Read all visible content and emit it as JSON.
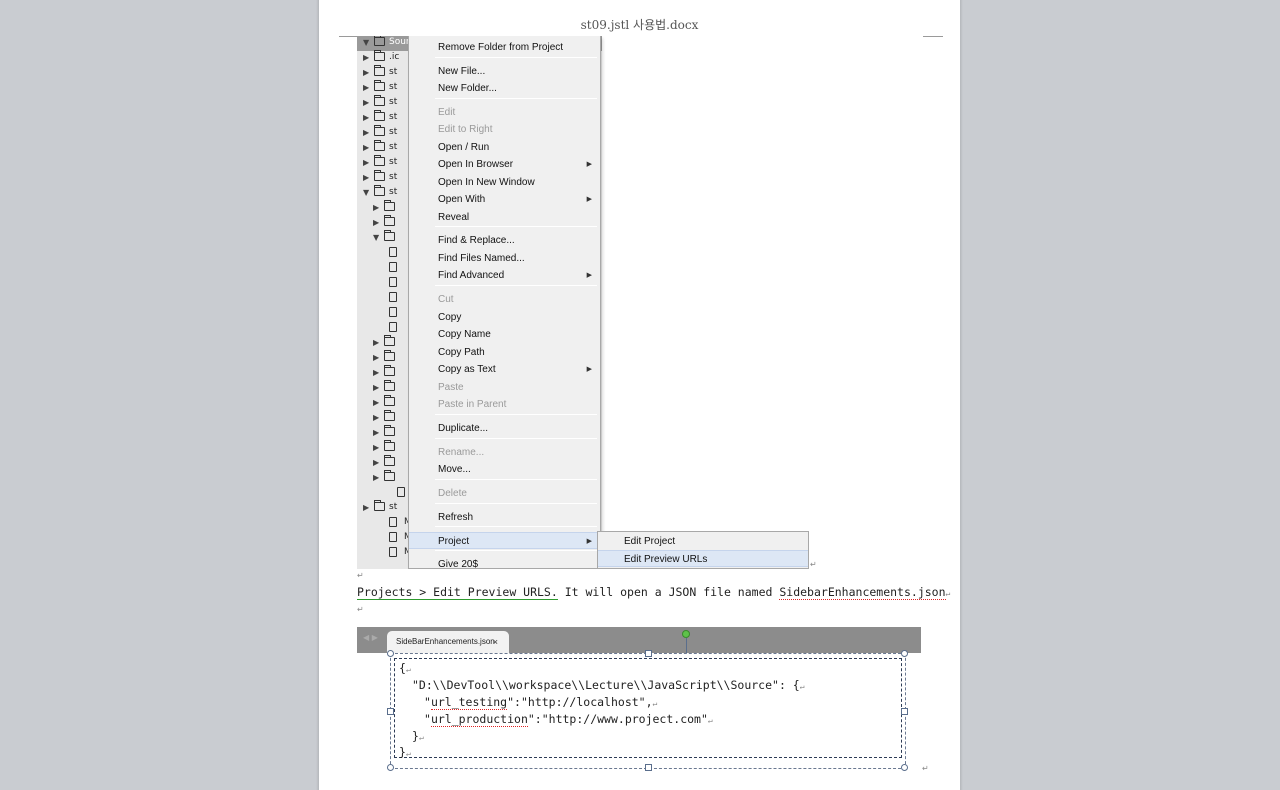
{
  "document": {
    "title": "st09.jstl 사용법.docx",
    "paragraph_mark": "↵"
  },
  "tree": {
    "root_label": "Sour",
    "rows": [
      {
        "label": ".ic"
      },
      {
        "label": "st"
      },
      {
        "label": "st"
      },
      {
        "label": "st"
      },
      {
        "label": "st"
      },
      {
        "label": "st"
      },
      {
        "label": "st"
      },
      {
        "label": "st"
      },
      {
        "label": "st"
      },
      {
        "label": "st"
      },
      {
        "label": "st"
      },
      {
        "label": "M"
      },
      {
        "label": "M"
      },
      {
        "label": "M"
      }
    ]
  },
  "context_menu": {
    "items": [
      {
        "label": "Remove Folder from Project",
        "enabled": true
      },
      {
        "label": "New File...",
        "enabled": true
      },
      {
        "label": "New Folder...",
        "enabled": true
      },
      {
        "label": "Edit",
        "enabled": false
      },
      {
        "label": "Edit to Right",
        "enabled": false
      },
      {
        "label": "Open / Run",
        "enabled": true
      },
      {
        "label": "Open In Browser",
        "enabled": true,
        "submenu": true
      },
      {
        "label": "Open In New Window",
        "enabled": true
      },
      {
        "label": "Open With",
        "enabled": true,
        "submenu": true
      },
      {
        "label": "Reveal",
        "enabled": true
      },
      {
        "label": "Find & Replace...",
        "enabled": true
      },
      {
        "label": "Find Files Named...",
        "enabled": true
      },
      {
        "label": "Find Advanced",
        "enabled": true,
        "submenu": true
      },
      {
        "label": "Cut",
        "enabled": false
      },
      {
        "label": "Copy",
        "enabled": true
      },
      {
        "label": "Copy Name",
        "enabled": true
      },
      {
        "label": "Copy Path",
        "enabled": true
      },
      {
        "label": "Copy as Text",
        "enabled": true,
        "submenu": true
      },
      {
        "label": "Paste",
        "enabled": false
      },
      {
        "label": "Paste in Parent",
        "enabled": false
      },
      {
        "label": "Duplicate...",
        "enabled": true
      },
      {
        "label": "Rename...",
        "enabled": false
      },
      {
        "label": "Move...",
        "enabled": true
      },
      {
        "label": "Delete",
        "enabled": false
      },
      {
        "label": "Refresh",
        "enabled": true
      },
      {
        "label": "Project",
        "enabled": true,
        "submenu": true,
        "highlighted": true
      },
      {
        "label": "Give 20$",
        "enabled": true
      }
    ],
    "submenu_arrow": "▶"
  },
  "project_submenu": {
    "items": [
      {
        "label": "Edit Project"
      },
      {
        "label": "Edit Preview URLs",
        "highlighted": true
      }
    ]
  },
  "body_text": {
    "link": "Projects > Edit Preview URLS.",
    "middle": " It will open a JSON file named ",
    "filename": "SidebarEnhancements.json"
  },
  "editor": {
    "tab_label": "SideBarEnhancements.json",
    "tab_close": "×",
    "nav_arrows": "◀ ▶",
    "code": {
      "open_brace": "{",
      "path_key": "\"D:\\\\DevTool\\\\workspace\\\\Lecture\\\\JavaScript\\\\Source\": {",
      "url_testing_key": "url_testing",
      "url_testing_val": "\"http://localhost\",",
      "url_production_key": "url_production",
      "url_production_val": "\"http://www.project.com\"",
      "inner_close": "}",
      "outer_close": "}"
    }
  }
}
